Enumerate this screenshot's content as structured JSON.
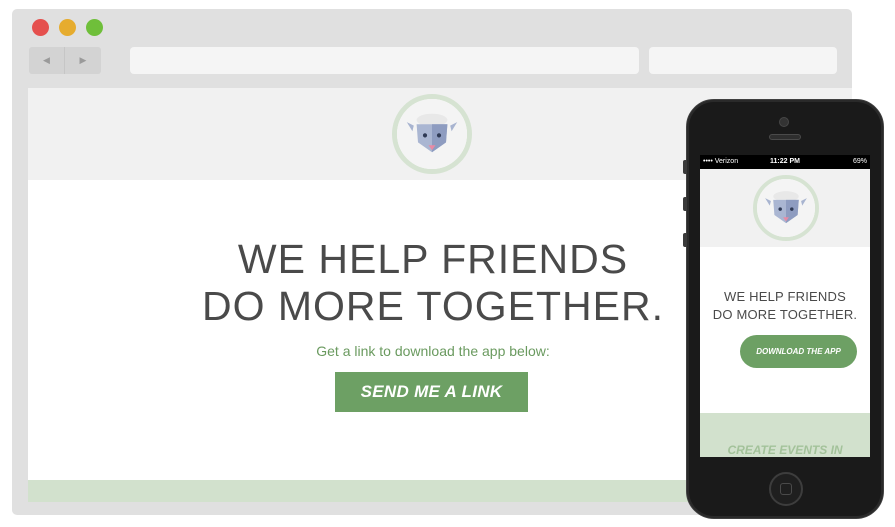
{
  "browser": {
    "nav": {
      "back_icon": "◀",
      "forward_icon": "▶"
    },
    "colors": {
      "close": "#e5504e",
      "minimize": "#e6ac2e",
      "maximize": "#6fbf3a"
    }
  },
  "site": {
    "headline_line1": "WE HELP FRIENDS",
    "headline_line2": "DO MORE TOGETHER.",
    "subtext": "Get a link to download the app below:",
    "cta_label": "SEND ME A LINK",
    "colors": {
      "accent_green": "#6da064",
      "pale_green": "#d2e1cd",
      "logo_ring": "#d6e3d2"
    }
  },
  "phone": {
    "status": {
      "carrier": "•••• Verizon",
      "time": "11:22 PM",
      "battery": "69%"
    },
    "headline_line1": "WE HELP FRIENDS",
    "headline_line2": "DO MORE TOGETHER.",
    "cta_label": "DOWNLOAD THE APP",
    "section_title": "CREATE EVENTS IN"
  },
  "icons": [
    "sheep-logo-icon",
    "back-arrow-icon",
    "forward-arrow-icon",
    "wifi-icon",
    "battery-icon"
  ]
}
